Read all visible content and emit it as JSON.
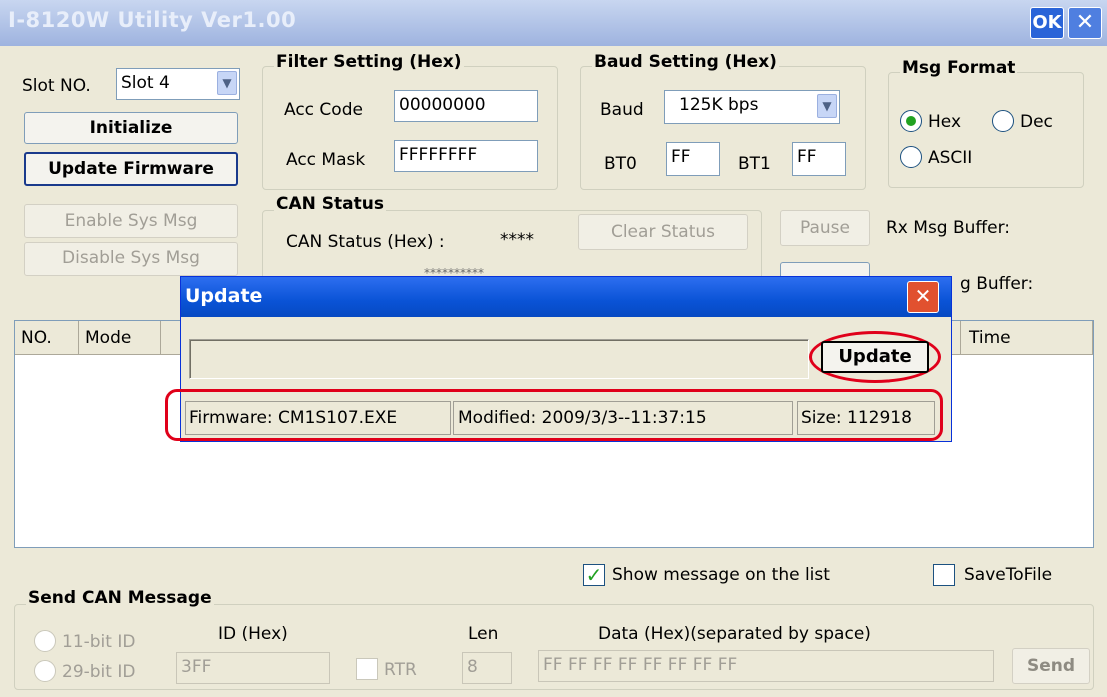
{
  "window": {
    "title": "I-8120W Utility Ver1.00",
    "ok_label": "OK",
    "close_label": "✕"
  },
  "left": {
    "slot_label": "Slot NO.",
    "slot_value": "Slot 4",
    "initialize": "Initialize",
    "update_firmware": "Update Firmware",
    "enable_sys_msg": "Enable Sys Msg",
    "disable_sys_msg": "Disable Sys Msg"
  },
  "filter": {
    "title": "Filter Setting (Hex)",
    "acc_code_label": "Acc Code",
    "acc_code": "00000000",
    "acc_mask_label": "Acc Mask",
    "acc_mask": "FFFFFFFF"
  },
  "baud": {
    "title": "Baud Setting (Hex)",
    "baud_label": "Baud",
    "baud_value": "125K bps",
    "bt0_label": "BT0",
    "bt0": "FF",
    "bt1_label": "BT1",
    "bt1": "FF"
  },
  "msg_format": {
    "title": "Msg Format",
    "hex": "Hex",
    "dec": "Dec",
    "ascii": "ASCII"
  },
  "can_status": {
    "title": "CAN Status",
    "label": "CAN Status (Hex) :",
    "value": "****",
    "clear": "Clear Status",
    "hidden_value": "**********"
  },
  "buffers": {
    "pause": "Pause",
    "rx": "Rx Msg Buffer:",
    "tx": "g Buffer:"
  },
  "list": {
    "columns": [
      "NO.",
      "Mode",
      "Time"
    ]
  },
  "dialog": {
    "title": "Update",
    "close": "✕",
    "update_button": "Update",
    "firmware": "Firmware: CM1S107.EXE",
    "modified": "Modified: 2009/3/3--11:37:15",
    "size": "Size: 112918"
  },
  "options": {
    "show_message": "Show message on the list",
    "save_to_file": "SaveToFile"
  },
  "send": {
    "title": "Send CAN Message",
    "bit11": "11-bit ID",
    "bit29": "29-bit ID",
    "id_label": "ID (Hex)",
    "id_value": "3FF",
    "rtr": "RTR",
    "len_label": "Len",
    "len_value": "8",
    "data_label": "Data (Hex)(separated by space)",
    "data_value": "FF FF FF FF FF FF FF FF",
    "send_button": "Send"
  },
  "colors": {
    "accent_red": "#e0001a",
    "title_blue": "#0a53d6"
  }
}
